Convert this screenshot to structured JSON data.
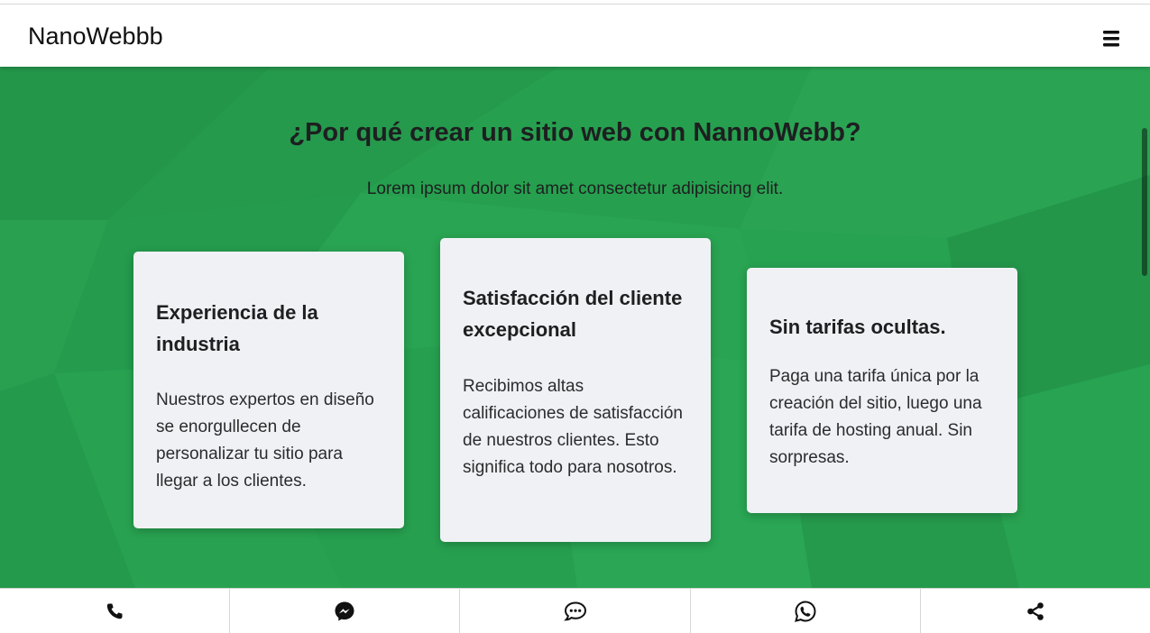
{
  "navbar": {
    "brand": "NanoWebbb",
    "menu_icon": "hamburger-menu-icon"
  },
  "hero": {
    "title": "¿Por qué crear un sitio web con NannoWebb?",
    "subtitle": "Lorem ipsum dolor sit amet consectetur adipisicing elit.",
    "background_color": "#27a04f"
  },
  "cards": [
    {
      "title": "Experiencia de la industria",
      "text": "Nuestros expertos en diseño se enorgullecen de personalizar tu sitio para llegar a los clientes."
    },
    {
      "title": "Satisfacción del cliente excepcional",
      "text": "Recibimos altas calificaciones de satisfacción de nuestros clientes. Esto significa todo para nosotros."
    },
    {
      "title": "Sin tarifas ocultas.",
      "text": "Paga una tarifa única por la creación del sitio, luego una tarifa de hosting anual. Sin sorpresas."
    }
  ],
  "bottom_bar": {
    "items": [
      {
        "icon": "phone-icon"
      },
      {
        "icon": "messenger-icon"
      },
      {
        "icon": "chat-bubble-icon"
      },
      {
        "icon": "whatsapp-icon"
      },
      {
        "icon": "share-icon"
      }
    ]
  }
}
